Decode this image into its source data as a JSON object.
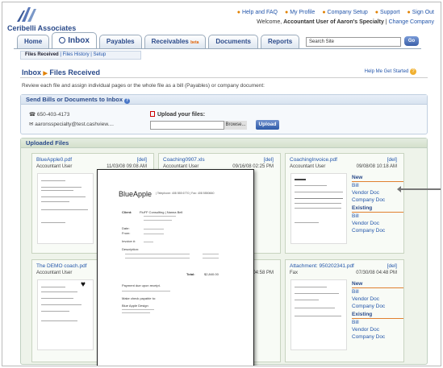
{
  "brand": {
    "name": "Ceribelli Associates"
  },
  "toplinks": [
    "Help and FAQ",
    "My Profile",
    "Company Setup",
    "Support",
    "Sign Out"
  ],
  "welcome": {
    "prefix": "Welcome,",
    "user": "Accountant User of Aaron's Specialty",
    "change": "Change Company"
  },
  "tabs": {
    "home": "Home",
    "inbox": "Inbox",
    "payables": "Payables",
    "receivables": "Receivables",
    "beta": "beta",
    "documents": "Documents",
    "reports": "Reports"
  },
  "search": {
    "placeholder": "Search Site",
    "go": "Go"
  },
  "subnav": {
    "received": "Files Received",
    "history": "Files History",
    "setup": "Setup"
  },
  "breadcrumb": {
    "root": "Inbox",
    "current": "Files Received"
  },
  "help_link": "Help Me Get Started",
  "instructions": "Review each file and assign individual pages or the whole file as a bill (Payables) or company document:",
  "send_panel": {
    "title": "Send Bills or Documents to Inbox",
    "phone": "650-403-4173",
    "email": "aaronsspecialty@test.cashview....",
    "upload_label": "Upload your files:",
    "browse": "Browse...",
    "upload_button": "Upload"
  },
  "uploaded_panel": {
    "title": "Uploaded Files"
  },
  "files": [
    {
      "name": "BlueApple0.pdf",
      "del": "[del]",
      "user": "Accountant User",
      "date": "11/03/08 09:08 AM"
    },
    {
      "name": "Coaching0907.xls",
      "del": "[del]",
      "user": "Accountant User",
      "date": "09/16/08 02:25 PM"
    },
    {
      "name": "CoachingInvoice.pdf",
      "del": "[del]",
      "user": "Accountant User",
      "date": "09/08/08 10:18 AM"
    },
    {
      "name": "The DEMO coach.pdf",
      "del": "",
      "user": "Accountant User",
      "date": ""
    },
    {
      "name": "",
      "del": "",
      "user": "",
      "date": "04:58 PM"
    },
    {
      "name": "Attachment: 950202341.pdf",
      "del": "[del]",
      "user": "Fax",
      "date": "07/30/08 04:48 PM"
    }
  ],
  "actions": {
    "new": "New",
    "existing": "Existing",
    "bill": "Bill",
    "vendor_doc": "Vendor Doc",
    "company_doc": "Company Doc",
    "partial_doc": "y Doc"
  },
  "preview": {
    "logo": "BlueApple",
    "contact": "| Telephone: 408 555 6770 | Fax: 408 5550660",
    "client_label": "Client:",
    "client": "FluFF Consulting | Nanna Bell",
    "date_label": "Date:",
    "from_label": "From:",
    "invoice_label": "Invoice #:",
    "desc_label": "Description:",
    "total_label": "Total:",
    "total": "$2,840.00",
    "pay_note": "Payment due upon receipt.",
    "check_note": "Make check payable to:",
    "payee": "Blue Apple Design"
  }
}
